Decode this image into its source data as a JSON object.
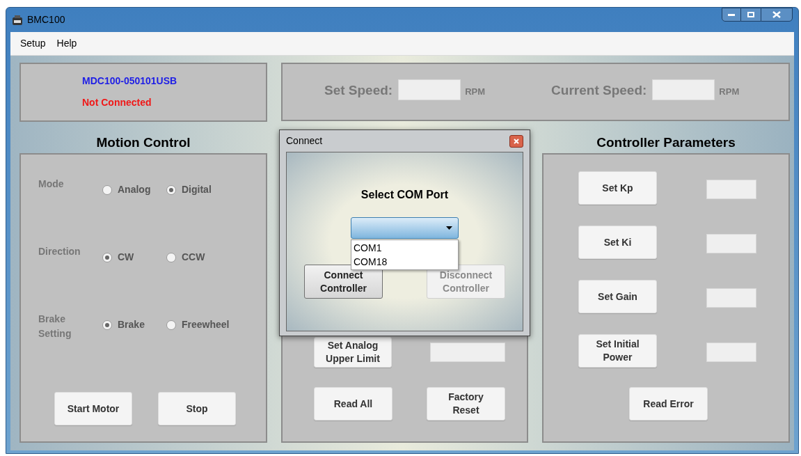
{
  "window": {
    "title": "BMC100"
  },
  "menu": [
    {
      "label": "Setup"
    },
    {
      "label": "Help"
    }
  ],
  "device": {
    "model": "MDC100-050101USB",
    "status": "Not Connected",
    "connected": false
  },
  "speed": {
    "set_label": "Set Speed:",
    "set_unit": "RPM",
    "current_label": "Current Speed:",
    "current_unit": "RPM",
    "disabled": true
  },
  "motion_control": {
    "title": "Motion Control",
    "disabled": true,
    "groups": [
      {
        "label": "Mode",
        "options": [
          {
            "label": "Analog",
            "selected": false
          },
          {
            "label": "Digital",
            "selected": true
          }
        ]
      },
      {
        "label": "Direction",
        "options": [
          {
            "label": "CW",
            "selected": true
          },
          {
            "label": "CCW",
            "selected": false
          }
        ]
      },
      {
        "label": "Brake Setting",
        "options": [
          {
            "label": "Brake",
            "selected": true
          },
          {
            "label": "Freewheel",
            "selected": false
          }
        ]
      }
    ],
    "buttons": [
      {
        "label": "Start Motor"
      },
      {
        "label": "Stop"
      }
    ]
  },
  "motor_parameters": {
    "analog_limit": {
      "label": "Set Analog Upper Limit"
    },
    "buttons": [
      {
        "label": "Read All"
      },
      {
        "label": "Factory Reset"
      }
    ]
  },
  "controller_parameters": {
    "title": "Controller Parameters",
    "params": [
      {
        "label": "Set Kp"
      },
      {
        "label": "Set Ki"
      },
      {
        "label": "Set Gain"
      },
      {
        "label": "Set Initial Power"
      }
    ],
    "button": {
      "label": "Read Error"
    }
  },
  "dialog": {
    "title": "Connect",
    "heading": "Select COM Port",
    "port_select": {
      "expanded": true,
      "options": [
        {
          "label": "COM1",
          "selected": false
        },
        {
          "label": "COM18",
          "selected": false
        }
      ]
    },
    "buttons": [
      {
        "label": "Connect Controller",
        "disabled": false
      },
      {
        "label": "Disconnect Controller",
        "disabled": true
      }
    ]
  }
}
